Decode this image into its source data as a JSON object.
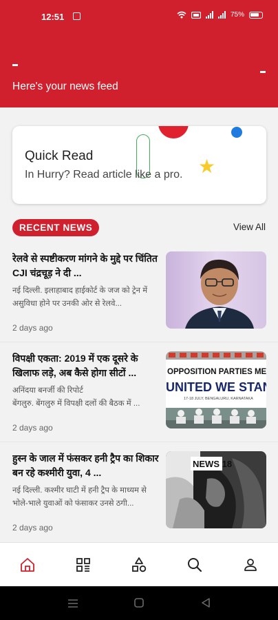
{
  "status_bar": {
    "time": "12:51",
    "battery": "75%"
  },
  "header": {
    "title": "Here's your news feed"
  },
  "quick_read": {
    "title": "Quick Read",
    "subtitle": "In Hurry? Read article like a pro."
  },
  "section": {
    "badge": "RECENT NEWS",
    "view_all": "View All"
  },
  "news": [
    {
      "title": "रेलवे से स्पष्टीकरण मांगने के मुद्दे पर चिंतित CJI चंद्रचूड़ ने दी ...",
      "summary": "नई दिल्ली. इलाहाबाद हाईकोर्ट के जज को ट्रेन में असुविधा होने पर उनकी ओर से रेलवे...",
      "date": "2 days ago"
    },
    {
      "title": "विपक्षी एकता: 2019 में एक दूसरे के खिलाफ लड़े, अब कैसे होगा सीटों ...",
      "summary": "अनिंदया बनर्जी की रिपोर्ट\nबेंगलुरु. बेंगलुरु में विपक्षी दलों की बैठक में ...",
      "date": "2 days ago",
      "thumb_text_1": "OPPOSITION PARTIES ME",
      "thumb_text_2": "UNITED WE STAN",
      "thumb_text_3": "17-18 JULY, BENGALURU, KARNATAKA"
    },
    {
      "title": "हुस्न के जाल में फंसकर हनी ट्रैप का शिकार बन रहे कश्मीरी युवा, 4 ...",
      "summary": "नई दिल्ली. कश्मीर घाटी में हनी ट्रैप के माध्यम से भोले-भाले युवाओं को फंसाकर उनसे ठगी...",
      "date": "2 days ago",
      "thumb_logo": "NEWS 18"
    }
  ],
  "nav": [
    "home-icon",
    "categories-icon",
    "shapes-icon",
    "search-icon",
    "profile-icon"
  ],
  "colors": {
    "brand_red": "#d0202e",
    "blue_dot": "#1f7bdf",
    "star_yellow": "#f6cb2a",
    "green": "#3fae57"
  }
}
